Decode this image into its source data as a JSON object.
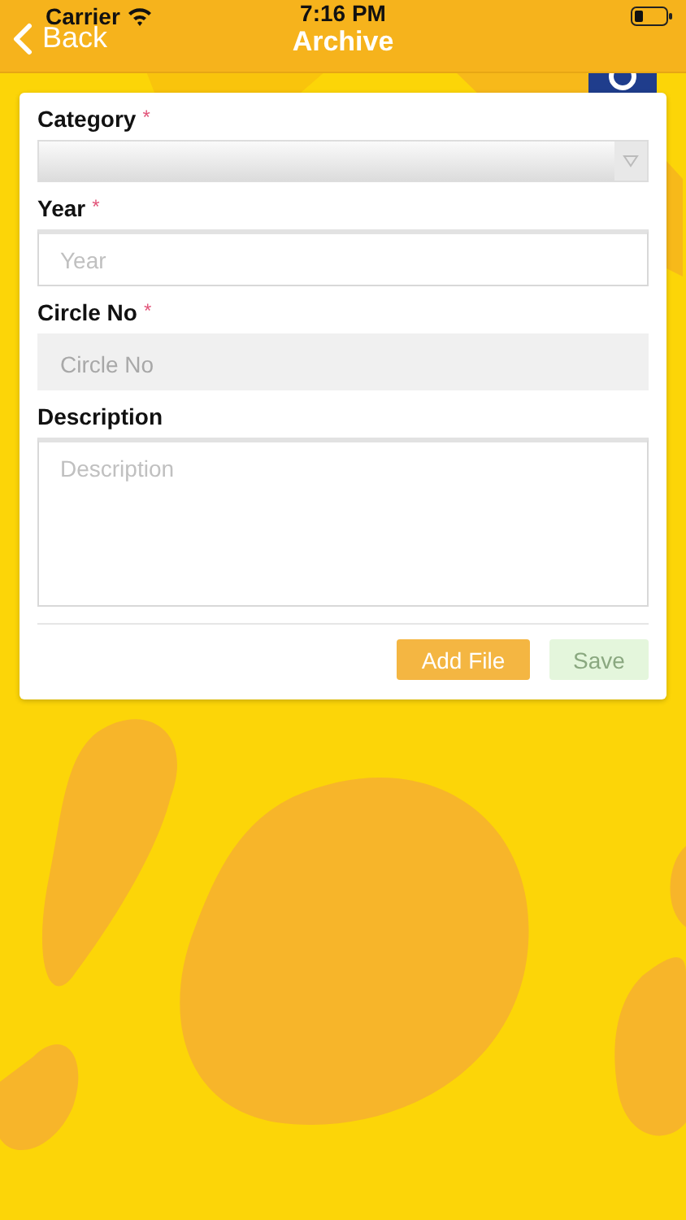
{
  "status_bar": {
    "carrier": "Carrier",
    "time": "7:16 PM"
  },
  "nav_bar": {
    "back": "Back",
    "title": "Archive"
  },
  "form": {
    "fields": [
      {
        "kind": "select",
        "label": "Category",
        "required_mark": "*",
        "disabled": false
      },
      {
        "kind": "text",
        "label": "Year",
        "required_mark": "*",
        "placeholder": "Year",
        "disabled": false
      },
      {
        "kind": "text",
        "label": "Circle No",
        "required_mark": "*",
        "placeholder": "Circle No",
        "disabled": true
      },
      {
        "kind": "textarea",
        "label": "Description",
        "placeholder": "Description",
        "disabled": false
      }
    ],
    "buttons": [
      {
        "label": "Add File",
        "disabled": false
      },
      {
        "label": "Save",
        "disabled": true
      }
    ]
  }
}
